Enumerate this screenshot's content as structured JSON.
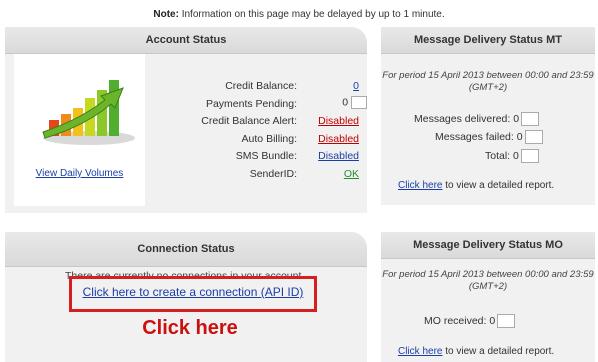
{
  "note": {
    "prefix": "Note:",
    "text": " Information on this page may be delayed by up to 1 minute."
  },
  "account": {
    "title": "Account Status",
    "view_link": "View Daily Volumes",
    "rows": [
      {
        "label": "Credit Balance:",
        "value": "0"
      },
      {
        "label": "Payments Pending:",
        "value": "0"
      },
      {
        "label": "Credit Balance Alert:",
        "value": "Disabled"
      },
      {
        "label": "Auto Billing:",
        "value": "Disabled"
      },
      {
        "label": "SMS Bundle:",
        "value": "Disabled"
      },
      {
        "label": "SenderID:",
        "value": "OK"
      }
    ]
  },
  "mt": {
    "title": "Message Delivery Status MT",
    "period": "For period 15 April 2013 between 00:00 and 23:59 (GMT+2)",
    "delivered_label": "Messages delivered:",
    "delivered_value": "0",
    "failed_label": "Messages failed:",
    "failed_value": "0",
    "total_label": "Total:",
    "total_value": "0",
    "report_link": "Click here",
    "report_text": " to view a detailed report."
  },
  "connection": {
    "title": "Connection Status",
    "message": "There are currently no connections in your account.",
    "create_link": "Click here to create a connection (API ID)",
    "annotation": "Click here"
  },
  "mo": {
    "title": "Message Delivery Status MO",
    "period": "For period 15 April 2013 between 00:00 and 23:59 (GMT+2)",
    "received_label": "MO received:",
    "received_value": "0",
    "report_link": "Click here",
    "report_text": " to view a detailed report."
  },
  "colors": {
    "link": "#1a3ea8",
    "alert": "#c00000",
    "ok": "#2a8a2a",
    "annotation": "#d42020"
  }
}
